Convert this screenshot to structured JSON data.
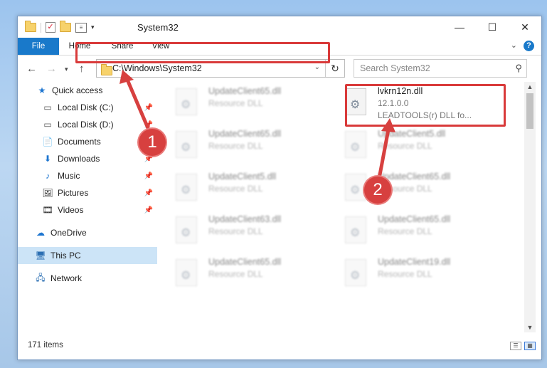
{
  "window": {
    "title": "System32",
    "controls": {
      "minimize": "—",
      "maximize": "☐",
      "close": "✕"
    }
  },
  "ribbon": {
    "tabs": [
      {
        "label": "File"
      },
      {
        "label": "Home"
      },
      {
        "label": "Share"
      },
      {
        "label": "View"
      }
    ],
    "help": "?"
  },
  "address": {
    "path": "C:\\Windows\\System32",
    "search_placeholder": "Search System32"
  },
  "sidebar": {
    "items": [
      {
        "label": "Quick access",
        "icon": "★",
        "pinned": false
      },
      {
        "label": "Local Disk (C:)",
        "icon": "▭",
        "pinned": true
      },
      {
        "label": "Local Disk (D:)",
        "icon": "▭",
        "pinned": true
      },
      {
        "label": "Documents",
        "icon": "📄",
        "pinned": true
      },
      {
        "label": "Downloads",
        "icon": "⬇",
        "pinned": true
      },
      {
        "label": "Music",
        "icon": "♪",
        "pinned": true
      },
      {
        "label": "Pictures",
        "icon": "🖼",
        "pinned": true
      },
      {
        "label": "Videos",
        "icon": "🎞",
        "pinned": true
      },
      {
        "label": "OneDrive",
        "icon": "☁",
        "pinned": false
      },
      {
        "label": "This PC",
        "icon": "🖥",
        "pinned": false
      },
      {
        "label": "Network",
        "icon": "🖧",
        "pinned": false
      }
    ],
    "pin_glyph": "📌"
  },
  "files": {
    "left_column": [
      {
        "name": "UpdateClient65.dll",
        "type": "Resource DLL"
      },
      {
        "name": "UpdateClient65.dll",
        "type": "Resource DLL"
      },
      {
        "name": "UpdateClient5.dll",
        "type": "Resource DLL"
      },
      {
        "name": "UpdateClient63.dll",
        "type": "Resource DLL"
      },
      {
        "name": "UpdateClient65.dll",
        "type": "Resource DLL"
      }
    ],
    "highlighted": {
      "name": "lvkrn12n.dll",
      "version": "12.1.0.0",
      "description": "LEADTOOLS(r) DLL fo..."
    },
    "right_column": [
      {
        "name": "UpdateClient5.dll",
        "type": "Resource DLL"
      },
      {
        "name": "UpdateClient65.dll",
        "type": "Resource DLL"
      },
      {
        "name": "UpdateClient65.dll",
        "type": "Resource DLL"
      },
      {
        "name": "UpdateClient19.dll",
        "type": "Resource DLL"
      }
    ]
  },
  "status": {
    "items": "171 items"
  },
  "annotations": {
    "marker1": "1",
    "marker2": "2",
    "color": "#d7403f"
  }
}
